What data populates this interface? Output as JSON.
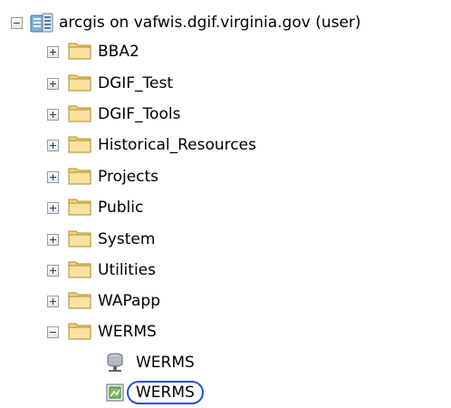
{
  "tree": {
    "root": {
      "label": "arcgis on vafwis.dgif.virginia.gov (user)",
      "expander": "minus",
      "icon": "server-connection-icon"
    },
    "folders": [
      {
        "label": "BBA2",
        "expander": "plus",
        "icon": "folder-icon"
      },
      {
        "label": "DGIF_Test",
        "expander": "plus",
        "icon": "folder-icon"
      },
      {
        "label": "DGIF_Tools",
        "expander": "plus",
        "icon": "folder-icon"
      },
      {
        "label": "Historical_Resources",
        "expander": "plus",
        "icon": "folder-icon"
      },
      {
        "label": "Projects",
        "expander": "plus",
        "icon": "folder-icon"
      },
      {
        "label": "Public",
        "expander": "plus",
        "icon": "folder-icon"
      },
      {
        "label": "System",
        "expander": "plus",
        "icon": "folder-icon"
      },
      {
        "label": "Utilities",
        "expander": "plus",
        "icon": "folder-icon"
      },
      {
        "label": "WAPapp",
        "expander": "plus",
        "icon": "folder-icon"
      },
      {
        "label": "WERMS",
        "expander": "minus",
        "icon": "folder-icon"
      }
    ],
    "children": [
      {
        "label": "WERMS",
        "icon": "map-service-icon"
      },
      {
        "label": "WERMS",
        "icon": "feature-service-icon",
        "selected": true
      }
    ]
  },
  "colors": {
    "folder": "#f2d57a",
    "selection_circle": "#2a4fd6"
  }
}
